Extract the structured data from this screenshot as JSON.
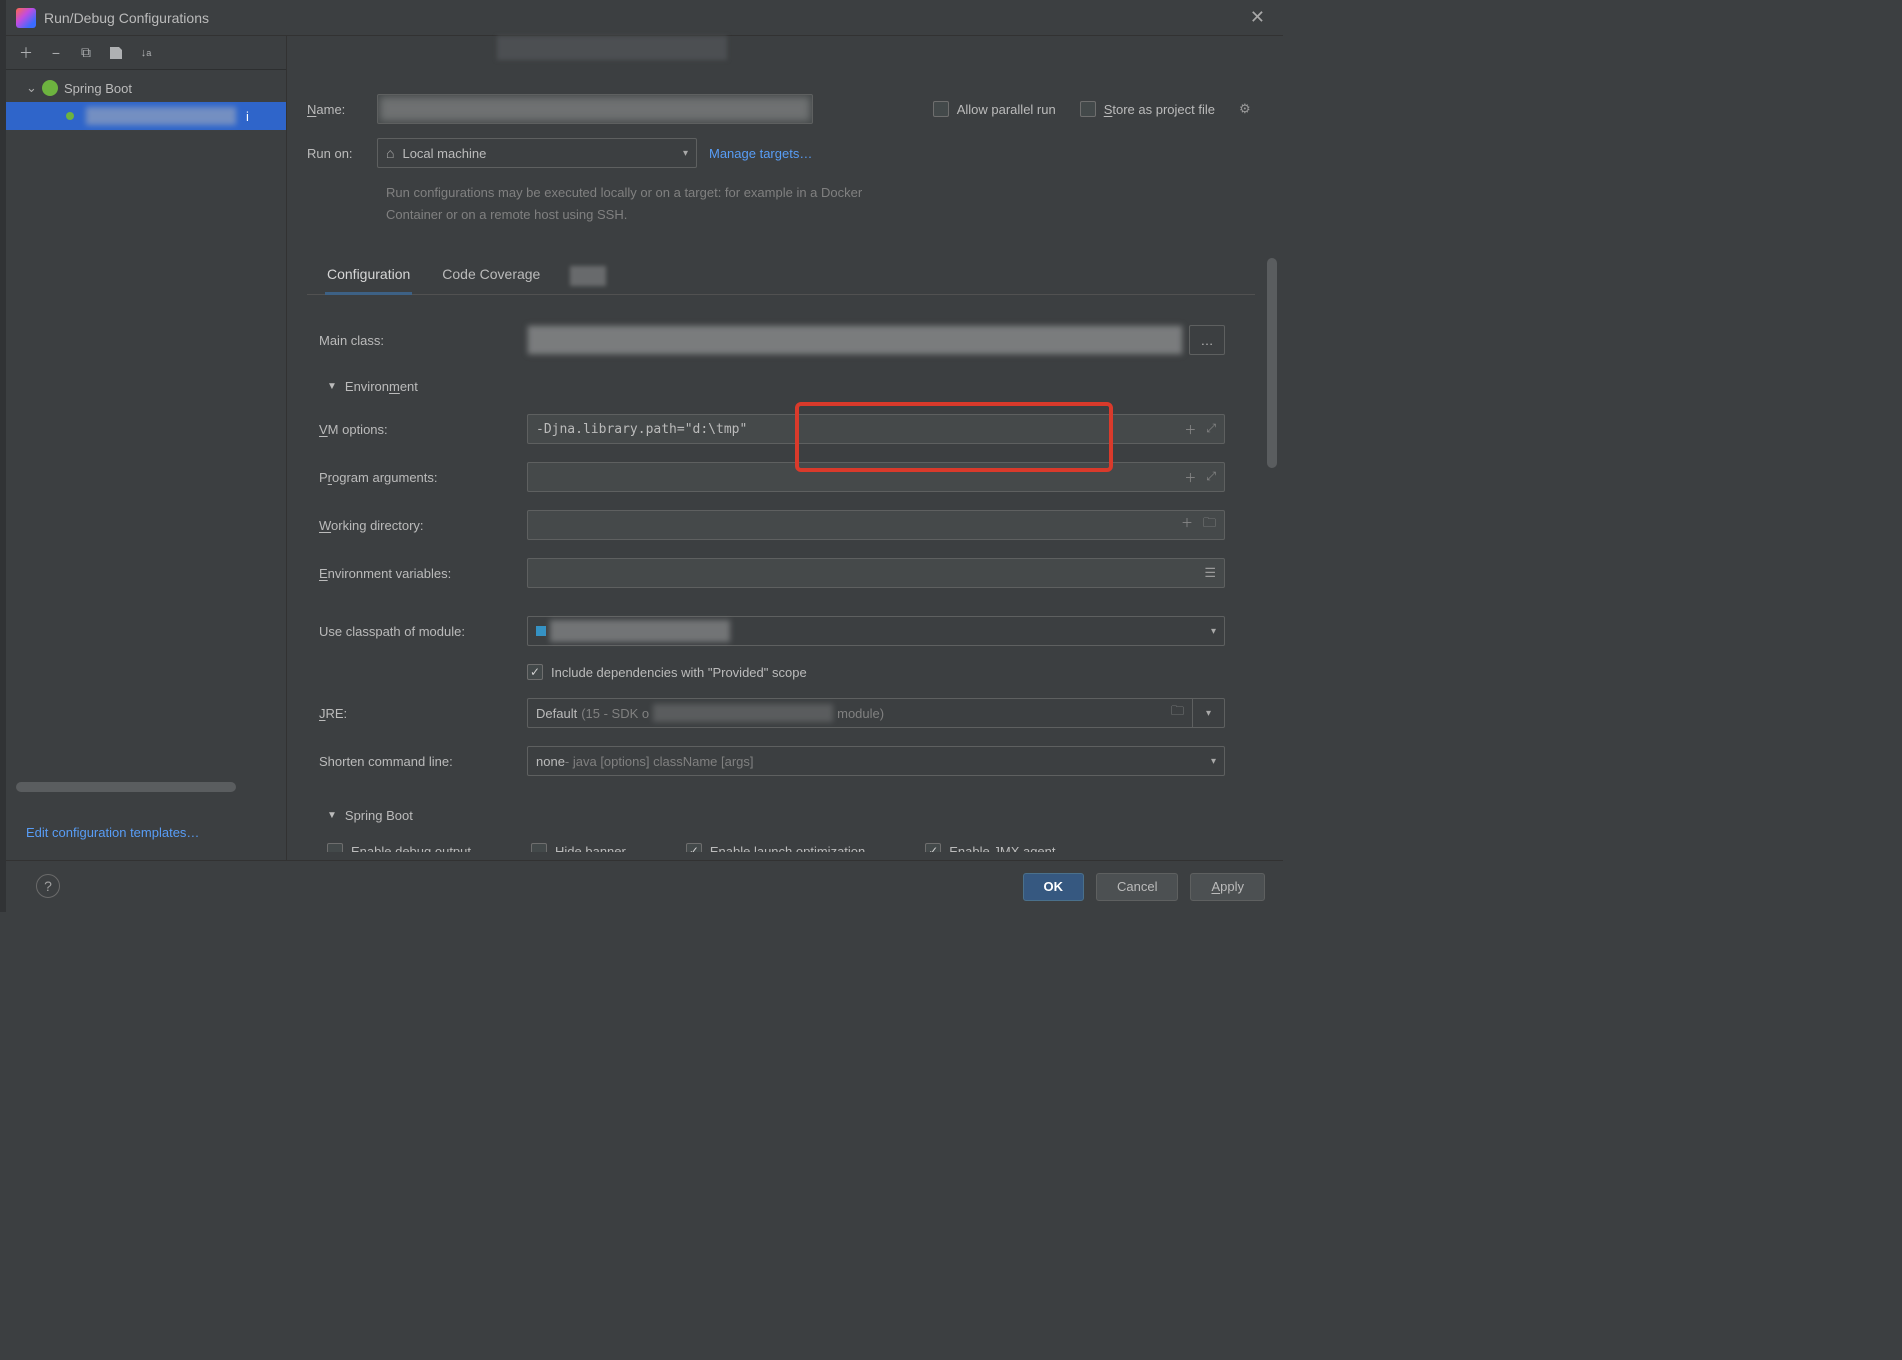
{
  "title": "Run/Debug Configurations",
  "toolbar": {
    "add": "＋",
    "remove": "−",
    "copy": "⧉",
    "save": "📄",
    "sort": "↓ᵃᶻ"
  },
  "tree": {
    "root": "Spring Boot"
  },
  "editTemplates": "Edit configuration templates…",
  "form": {
    "nameLabel": "Name:",
    "allowParallel": "Allow parallel run",
    "storeAsProject": "Store as project file",
    "runOnLabel": "Run on:",
    "runOnValue": "Local machine",
    "manageTargets": "Manage targets…",
    "desc": "Run configurations may be executed locally or on a target: for example in a Docker Container or on a remote host using SSH."
  },
  "tabs": {
    "configuration": "Configuration",
    "coverage": "Code Coverage"
  },
  "config": {
    "mainClassLabel": "Main class:",
    "envSection": "Environment",
    "vmLabel": "VM options:",
    "vmValue": "-Djna.library.path=\"d:\\tmp\"",
    "progArgsLabel": "Program arguments:",
    "workDirLabel": "Working directory:",
    "envVarsLabel": "Environment variables:",
    "classpathLabel": "Use classpath of module:",
    "includeProvided": "Include dependencies with \"Provided\" scope",
    "jreLabel": "JRE:",
    "jreDefault": "Default",
    "jreHint1": "(15 - SDK o",
    "jreHint2": "module)",
    "shortenLabel": "Shorten command line:",
    "shortenValue": "none",
    "shortenHint": " - java [options] className [args]",
    "sbSection": "Spring Boot",
    "enableDebug": "Enable debug output",
    "hideBanner": "Hide banner",
    "enableLaunchOpt": "Enable launch optimization",
    "enableJmx": "Enable JMX agent"
  },
  "buttons": {
    "ok": "OK",
    "cancel": "Cancel",
    "apply": "Apply"
  }
}
